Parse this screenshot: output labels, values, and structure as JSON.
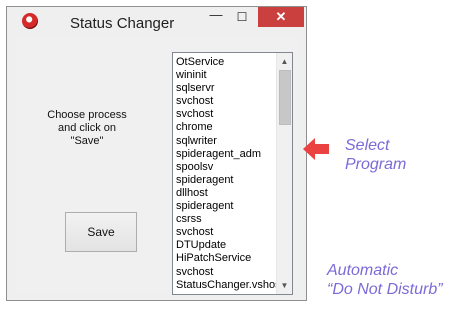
{
  "window": {
    "title": "Status Changer",
    "controls": {
      "minimize": "—",
      "maximize": "☐",
      "close": "✕"
    }
  },
  "instructions": {
    "line1": "Choose process",
    "line2": "and click on",
    "line3": "\"Save\""
  },
  "save_button": {
    "label": "Save"
  },
  "process_list": {
    "items": [
      "OtService",
      "wininit",
      "sqlservr",
      "svchost",
      "svchost",
      "chrome",
      "sqlwriter",
      "spideragent_adm",
      "spoolsv",
      "spideragent",
      "dllhost",
      "spideragent",
      "csrss",
      "svchost",
      "DTUpdate",
      "HiPatchService",
      "svchost",
      "StatusChanger.vshost"
    ]
  },
  "annotations": {
    "select_program": {
      "line1": "Select",
      "line2": "Program"
    },
    "automatic": {
      "line1": "Automatic",
      "line2": "“Do Not Disturb”"
    },
    "color": "#7b6ad8",
    "arrow_color": "#ea4141"
  }
}
